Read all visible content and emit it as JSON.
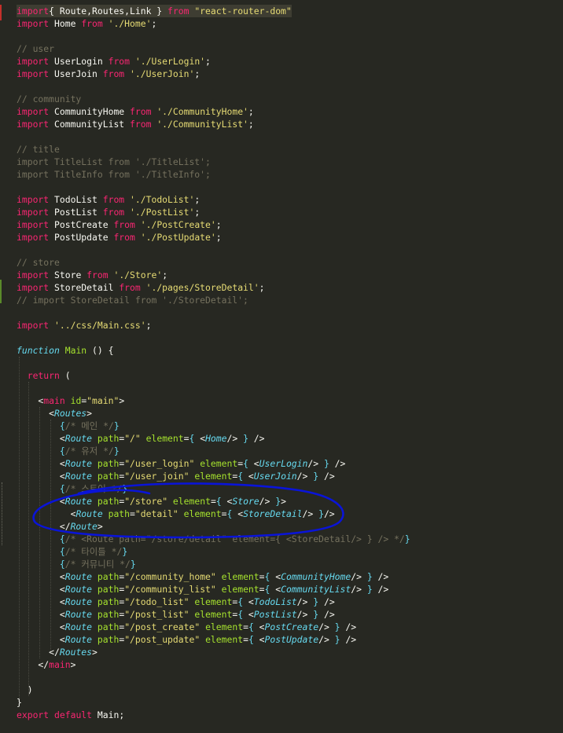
{
  "colors": {
    "background": "#272822",
    "keyword": "#f92672",
    "string": "#e6db74",
    "comment": "#75715e",
    "function": "#a6e22e",
    "component": "#66d9ef",
    "annotation": "#0a14d8"
  },
  "lines": [
    [
      [
        "kw",
        "import"
      ],
      [
        "",
        "{ Route,Routes,Link } "
      ],
      [
        "kw",
        "from"
      ],
      [
        "",
        " "
      ],
      [
        "str",
        "\"react-router-dom\""
      ]
    ],
    [
      [
        "kw",
        "import"
      ],
      [
        "",
        " Home "
      ],
      [
        "kw",
        "from"
      ],
      [
        "",
        " "
      ],
      [
        "str",
        "'./Home'"
      ],
      [
        "",
        ";"
      ]
    ],
    [],
    [
      [
        "cm",
        "// user"
      ]
    ],
    [
      [
        "kw",
        "import"
      ],
      [
        "",
        " UserLogin "
      ],
      [
        "kw",
        "from"
      ],
      [
        "",
        " "
      ],
      [
        "str",
        "'./UserLogin'"
      ],
      [
        "",
        ";"
      ]
    ],
    [
      [
        "kw",
        "import"
      ],
      [
        "",
        " UserJoin "
      ],
      [
        "kw",
        "from"
      ],
      [
        "",
        " "
      ],
      [
        "str",
        "'./UserJoin'"
      ],
      [
        "",
        ";"
      ]
    ],
    [],
    [
      [
        "cm",
        "// community"
      ]
    ],
    [
      [
        "kw",
        "import"
      ],
      [
        "",
        " CommunityHome "
      ],
      [
        "kw",
        "from"
      ],
      [
        "",
        " "
      ],
      [
        "str",
        "'./CommunityHome'"
      ],
      [
        "",
        ";"
      ]
    ],
    [
      [
        "kw",
        "import"
      ],
      [
        "",
        " CommunityList "
      ],
      [
        "kw",
        "from"
      ],
      [
        "",
        " "
      ],
      [
        "str",
        "'./CommunityList'"
      ],
      [
        "",
        ";"
      ]
    ],
    [],
    [
      [
        "cm",
        "// title"
      ]
    ],
    [
      [
        "cm",
        "import TitleList from './TitleList';"
      ]
    ],
    [
      [
        "cm",
        "import TitleInfo from './TitleInfo';"
      ]
    ],
    [],
    [
      [
        "kw",
        "import"
      ],
      [
        "",
        " TodoList "
      ],
      [
        "kw",
        "from"
      ],
      [
        "",
        " "
      ],
      [
        "str",
        "'./TodoList'"
      ],
      [
        "",
        ";"
      ]
    ],
    [
      [
        "kw",
        "import"
      ],
      [
        "",
        " PostList "
      ],
      [
        "kw",
        "from"
      ],
      [
        "",
        " "
      ],
      [
        "str",
        "'./PostList'"
      ],
      [
        "",
        ";"
      ]
    ],
    [
      [
        "kw",
        "import"
      ],
      [
        "",
        " PostCreate "
      ],
      [
        "kw",
        "from"
      ],
      [
        "",
        " "
      ],
      [
        "str",
        "'./PostCreate'"
      ],
      [
        "",
        ";"
      ]
    ],
    [
      [
        "kw",
        "import"
      ],
      [
        "",
        " PostUpdate "
      ],
      [
        "kw",
        "from"
      ],
      [
        "",
        " "
      ],
      [
        "str",
        "'./PostUpdate'"
      ],
      [
        "",
        ";"
      ]
    ],
    [],
    [
      [
        "cm",
        "// store"
      ]
    ],
    [
      [
        "kw",
        "import"
      ],
      [
        "",
        " Store "
      ],
      [
        "kw",
        "from"
      ],
      [
        "",
        " "
      ],
      [
        "str",
        "'./Store'"
      ],
      [
        "",
        ";"
      ]
    ],
    [
      [
        "kw",
        "import"
      ],
      [
        "",
        " StoreDetail "
      ],
      [
        "kw",
        "from"
      ],
      [
        "",
        " "
      ],
      [
        "str",
        "'./pages/StoreDetail'"
      ],
      [
        "",
        ";"
      ]
    ],
    [
      [
        "cm",
        "// import StoreDetail from './StoreDetail';"
      ]
    ],
    [],
    [
      [
        "kw",
        "import"
      ],
      [
        "",
        " "
      ],
      [
        "str",
        "'../css/Main.css'"
      ],
      [
        "",
        ";"
      ]
    ],
    [],
    [
      [
        "kwi",
        "function"
      ],
      [
        "",
        " "
      ],
      [
        "fn",
        "Main"
      ],
      [
        "",
        " () {"
      ]
    ],
    [],
    [
      [
        "",
        ""
      ],
      [
        "kw",
        "  return"
      ],
      [
        "",
        " ("
      ]
    ],
    [],
    [
      [
        "",
        "    <"
      ],
      [
        "tag",
        "main"
      ],
      [
        "",
        " "
      ],
      [
        "attr",
        "id"
      ],
      [
        "",
        "="
      ],
      [
        "str",
        "\"main\""
      ],
      [
        "",
        ">"
      ]
    ],
    [
      [
        "",
        "      <"
      ],
      [
        "cmp",
        "Routes"
      ],
      [
        "",
        ">"
      ]
    ],
    [
      [
        "",
        "        "
      ],
      [
        "brc",
        "{"
      ],
      [
        "cm",
        "/* 메인 */"
      ],
      [
        "brc",
        "}"
      ]
    ],
    [
      [
        "",
        "        <"
      ],
      [
        "cmp",
        "Route"
      ],
      [
        "",
        " "
      ],
      [
        "attr",
        "path"
      ],
      [
        "",
        "="
      ],
      [
        "str",
        "\"/\""
      ],
      [
        "",
        " "
      ],
      [
        "attr",
        "element"
      ],
      [
        "",
        "="
      ],
      [
        "brc",
        "{"
      ],
      [
        "",
        " <"
      ],
      [
        "cmp",
        "Home"
      ],
      [
        "",
        "/> "
      ],
      [
        "brc",
        "}"
      ],
      [
        "",
        " />"
      ]
    ],
    [
      [
        "",
        "        "
      ],
      [
        "brc",
        "{"
      ],
      [
        "cm",
        "/* 유저 */"
      ],
      [
        "brc",
        "}"
      ]
    ],
    [
      [
        "",
        "        <"
      ],
      [
        "cmp",
        "Route"
      ],
      [
        "",
        " "
      ],
      [
        "attr",
        "path"
      ],
      [
        "",
        "="
      ],
      [
        "str",
        "\"/user_login\""
      ],
      [
        "",
        " "
      ],
      [
        "attr",
        "element"
      ],
      [
        "",
        "="
      ],
      [
        "brc",
        "{"
      ],
      [
        "",
        " <"
      ],
      [
        "cmp",
        "UserLogin"
      ],
      [
        "",
        "/> "
      ],
      [
        "brc",
        "}"
      ],
      [
        "",
        " />"
      ]
    ],
    [
      [
        "",
        "        <"
      ],
      [
        "cmp",
        "Route"
      ],
      [
        "",
        " "
      ],
      [
        "attr",
        "path"
      ],
      [
        "",
        "="
      ],
      [
        "str",
        "\"/user_join\""
      ],
      [
        "",
        " "
      ],
      [
        "attr",
        "element"
      ],
      [
        "",
        "="
      ],
      [
        "brc",
        "{"
      ],
      [
        "",
        " <"
      ],
      [
        "cmp",
        "UserJoin"
      ],
      [
        "",
        "/> "
      ],
      [
        "brc",
        "}"
      ],
      [
        "",
        " />"
      ]
    ],
    [
      [
        "",
        "        "
      ],
      [
        "brc",
        "{"
      ],
      [
        "cm",
        "/* 스토어 */"
      ],
      [
        "brc",
        "}"
      ]
    ],
    [
      [
        "",
        "        <"
      ],
      [
        "cmp",
        "Route"
      ],
      [
        "",
        " "
      ],
      [
        "attr",
        "path"
      ],
      [
        "",
        "="
      ],
      [
        "str",
        "\"/store\""
      ],
      [
        "",
        " "
      ],
      [
        "attr",
        "element"
      ],
      [
        "",
        "="
      ],
      [
        "brc",
        "{"
      ],
      [
        "",
        " <"
      ],
      [
        "cmp",
        "Store"
      ],
      [
        "",
        "/> "
      ],
      [
        "brc",
        "}"
      ],
      [
        "",
        ">"
      ]
    ],
    [
      [
        "",
        "          <"
      ],
      [
        "cmp",
        "Route"
      ],
      [
        "",
        " "
      ],
      [
        "attr",
        "path"
      ],
      [
        "",
        "="
      ],
      [
        "str",
        "\"detail\""
      ],
      [
        "",
        " "
      ],
      [
        "attr",
        "element"
      ],
      [
        "",
        "="
      ],
      [
        "brc",
        "{"
      ],
      [
        "",
        " <"
      ],
      [
        "cmp",
        "StoreDetail"
      ],
      [
        "",
        "/> "
      ],
      [
        "brc",
        "}"
      ],
      [
        "",
        "/>"
      ]
    ],
    [
      [
        "",
        "        </"
      ],
      [
        "cmp",
        "Route"
      ],
      [
        "",
        ">"
      ]
    ],
    [
      [
        "",
        "        "
      ],
      [
        "brc",
        "{"
      ],
      [
        "cm",
        "/* <Route path=\"/store/detail\" element={ <StoreDetail/> } /> */"
      ],
      [
        "brc",
        "}"
      ]
    ],
    [
      [
        "",
        "        "
      ],
      [
        "brc",
        "{"
      ],
      [
        "cm",
        "/* 타이틀 */"
      ],
      [
        "brc",
        "}"
      ]
    ],
    [
      [
        "",
        "        "
      ],
      [
        "brc",
        "{"
      ],
      [
        "cm",
        "/* 커뮤니티 */"
      ],
      [
        "brc",
        "}"
      ]
    ],
    [
      [
        "",
        "        <"
      ],
      [
        "cmp",
        "Route"
      ],
      [
        "",
        " "
      ],
      [
        "attr",
        "path"
      ],
      [
        "",
        "="
      ],
      [
        "str",
        "\"/community_home\""
      ],
      [
        "",
        " "
      ],
      [
        "attr",
        "element"
      ],
      [
        "",
        "="
      ],
      [
        "brc",
        "{"
      ],
      [
        "",
        " <"
      ],
      [
        "cmp",
        "CommunityHome"
      ],
      [
        "",
        "/> "
      ],
      [
        "brc",
        "}"
      ],
      [
        "",
        " />"
      ]
    ],
    [
      [
        "",
        "        <"
      ],
      [
        "cmp",
        "Route"
      ],
      [
        "",
        " "
      ],
      [
        "attr",
        "path"
      ],
      [
        "",
        "="
      ],
      [
        "str",
        "\"/community_list\""
      ],
      [
        "",
        " "
      ],
      [
        "attr",
        "element"
      ],
      [
        "",
        "="
      ],
      [
        "brc",
        "{"
      ],
      [
        "",
        " <"
      ],
      [
        "cmp",
        "CommunityList"
      ],
      [
        "",
        "/> "
      ],
      [
        "brc",
        "}"
      ],
      [
        "",
        " />"
      ]
    ],
    [
      [
        "",
        "        <"
      ],
      [
        "cmp",
        "Route"
      ],
      [
        "",
        " "
      ],
      [
        "attr",
        "path"
      ],
      [
        "",
        "="
      ],
      [
        "str",
        "\"/todo_list\""
      ],
      [
        "",
        " "
      ],
      [
        "attr",
        "element"
      ],
      [
        "",
        "="
      ],
      [
        "brc",
        "{"
      ],
      [
        "",
        " <"
      ],
      [
        "cmp",
        "TodoList"
      ],
      [
        "",
        "/> "
      ],
      [
        "brc",
        "}"
      ],
      [
        "",
        " />"
      ]
    ],
    [
      [
        "",
        "        <"
      ],
      [
        "cmp",
        "Route"
      ],
      [
        "",
        " "
      ],
      [
        "attr",
        "path"
      ],
      [
        "",
        "="
      ],
      [
        "str",
        "\"/post_list\""
      ],
      [
        "",
        " "
      ],
      [
        "attr",
        "element"
      ],
      [
        "",
        "="
      ],
      [
        "brc",
        "{"
      ],
      [
        "",
        " <"
      ],
      [
        "cmp",
        "PostList"
      ],
      [
        "",
        "/> "
      ],
      [
        "brc",
        "}"
      ],
      [
        "",
        " />"
      ]
    ],
    [
      [
        "",
        "        <"
      ],
      [
        "cmp",
        "Route"
      ],
      [
        "",
        " "
      ],
      [
        "attr",
        "path"
      ],
      [
        "",
        "="
      ],
      [
        "str",
        "\"/post_create\""
      ],
      [
        "",
        " "
      ],
      [
        "attr",
        "element"
      ],
      [
        "",
        "="
      ],
      [
        "brc",
        "{"
      ],
      [
        "",
        " <"
      ],
      [
        "cmp",
        "PostCreate"
      ],
      [
        "",
        "/> "
      ],
      [
        "brc",
        "}"
      ],
      [
        "",
        " />"
      ]
    ],
    [
      [
        "",
        "        <"
      ],
      [
        "cmp",
        "Route"
      ],
      [
        "",
        " "
      ],
      [
        "attr",
        "path"
      ],
      [
        "",
        "="
      ],
      [
        "str",
        "\"/post_update\""
      ],
      [
        "",
        " "
      ],
      [
        "attr",
        "element"
      ],
      [
        "",
        "="
      ],
      [
        "brc",
        "{"
      ],
      [
        "",
        " <"
      ],
      [
        "cmp",
        "PostUpdate"
      ],
      [
        "",
        "/> "
      ],
      [
        "brc",
        "}"
      ],
      [
        "",
        " />"
      ]
    ],
    [
      [
        "",
        "      </"
      ],
      [
        "cmp",
        "Routes"
      ],
      [
        "",
        ">"
      ]
    ],
    [
      [
        "",
        "    </"
      ],
      [
        "tag",
        "main"
      ],
      [
        "",
        ">"
      ]
    ],
    [],
    [
      [
        "",
        "  )"
      ]
    ],
    [
      [
        "",
        "}"
      ]
    ],
    [
      [
        "kw",
        "export"
      ],
      [
        "",
        " "
      ],
      [
        "kw",
        "default"
      ],
      [
        "",
        " Main;"
      ]
    ]
  ]
}
